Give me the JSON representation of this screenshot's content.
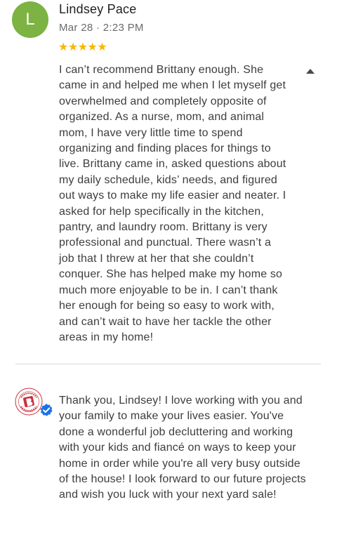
{
  "review": {
    "avatar_letter": "L",
    "avatar_color": "#7cb342",
    "reviewer_name": "Lindsey Pace",
    "date": "Mar 28 · 2:23 PM",
    "rating_stars": "★★★★★",
    "rating_value": 5,
    "star_color": "#f5b800",
    "text": "I can’t recommend Brittany enough. She came in and helped me when I let myself get overwhelmed and completely opposite of organized. As a nurse, mom, and animal mom, I have very little time to spend organizing and finding places for things to live. Brittany came in, asked questions about my daily schedule, kids’ needs, and figured out ways to make my life easier and neater. I asked for help specifically in the kitchen, pantry, and laundry room. Brittany is very professional and punctual. There wasn’t a job that I threw at her that she couldn’t conquer. She has helped make my home so much more enjoyable to be in. I can’t thank her enough for being so easy to work with, and can’t wait to have her tackle the other areas in my home!",
    "collapse_icon": "collapse-caret-icon"
  },
  "owner_response": {
    "logo_icon": "business-logo-icon",
    "logo_color": "#c8323c",
    "verified_icon": "verified-badge-icon",
    "verified_color": "#1a73e8",
    "text": "Thank you, Lindsey! I love working with you and your family to make your lives easier. You've done a wonderful job decluttering and working with your kids and fiancé on ways to keep your home in order while you're all very busy outside of the house! I look forward to our future projects and wish you luck with your next yard sale!"
  }
}
